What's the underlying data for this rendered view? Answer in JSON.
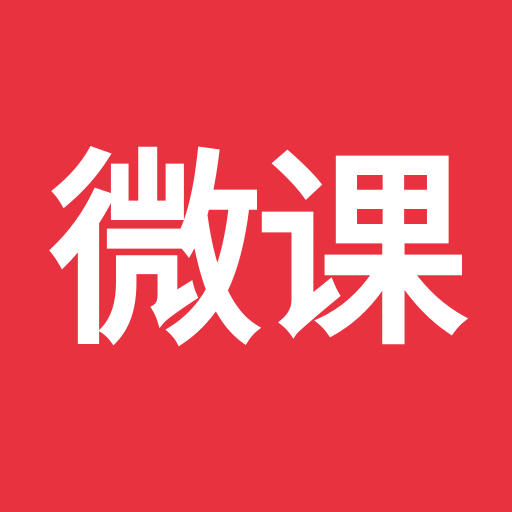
{
  "app_icon": {
    "logo_text": "微课",
    "background_color": "#e8323f",
    "text_color": "#ffffff"
  }
}
